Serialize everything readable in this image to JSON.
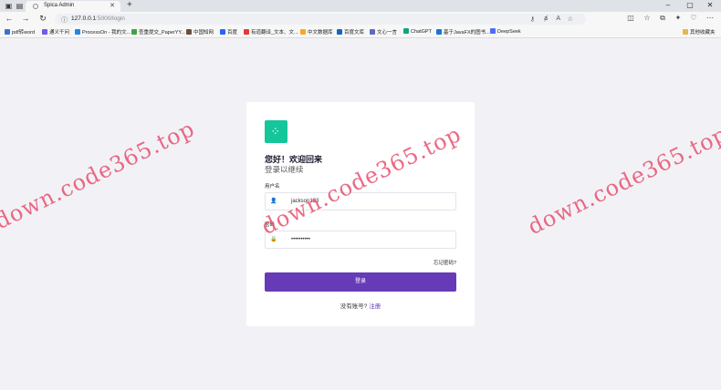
{
  "browser": {
    "tab_title": "Spica Admin",
    "url_host": "127.0.0.1",
    "url_path": ":5000/login",
    "bookmarks": [
      {
        "label": "pdf转word",
        "color": "#3b6fd6"
      },
      {
        "label": "通义千问",
        "color": "#6b5cf0"
      },
      {
        "label": "ProcessOn - 我的文...",
        "color": "#1e88e5"
      },
      {
        "label": "查重提交_PaperYY...",
        "color": "#43a047"
      },
      {
        "label": "中国知网",
        "color": "#6d4c41"
      },
      {
        "label": "百度",
        "color": "#2962ff"
      },
      {
        "label": "有道翻译_文本、文...",
        "color": "#e53935"
      },
      {
        "label": "中文数据库",
        "color": "#f9a825"
      },
      {
        "label": "百度文库",
        "color": "#1565c0"
      },
      {
        "label": "文心一言",
        "color": "#5c6bc0"
      },
      {
        "label": "ChatGPT",
        "color": "#10a37f"
      },
      {
        "label": "基于JavaFX的图书...",
        "color": "#1976d2"
      },
      {
        "label": "DeepSeek",
        "color": "#4d6bfe"
      }
    ],
    "other_bookmarks": "其他收藏夹"
  },
  "login": {
    "greeting": "您好！欢迎回来",
    "subtitle": "登录以继续",
    "username_label": "用户名",
    "username_value": "jackson123",
    "password_label": "密码",
    "password_value": "••••••••••",
    "forgot_link": "忘记密码?",
    "login_button": "登录",
    "no_account": "没有账号?",
    "register_link": "注册"
  },
  "watermark": "down.code365.top",
  "colors": {
    "accent": "#673ab7",
    "logo": "#15c69a"
  }
}
